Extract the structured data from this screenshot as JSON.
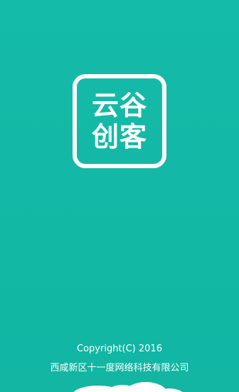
{
  "splash": {
    "logo": {
      "line1": "云谷",
      "line2": "创客"
    },
    "copyright": "Copyright(C) 2016",
    "company": "西咸新区十一度网络科技有限公司"
  },
  "colors": {
    "background": "#13b8a6",
    "foreground": "#ffffff"
  },
  "icons": {
    "decoration": "cloud-icon"
  }
}
